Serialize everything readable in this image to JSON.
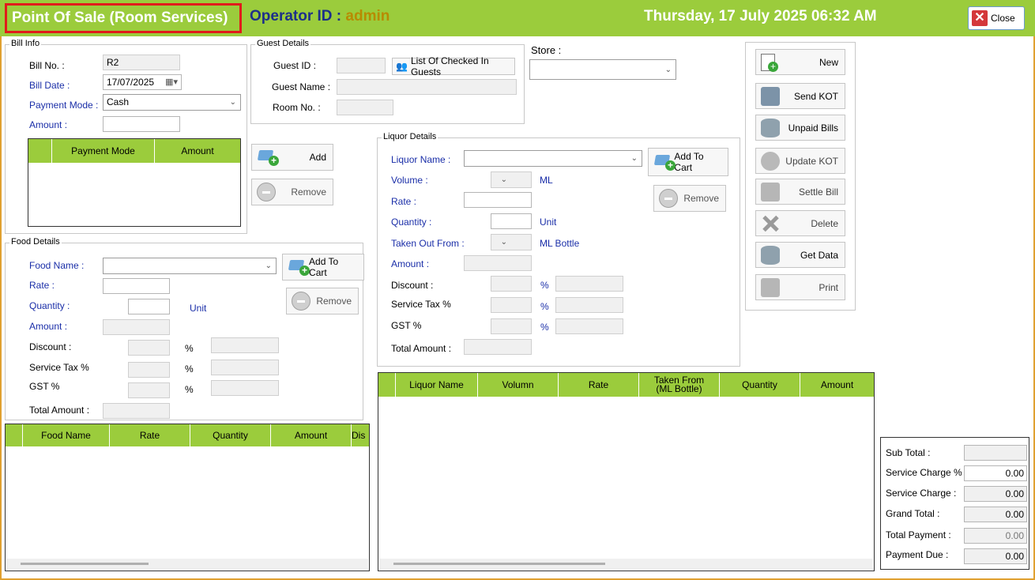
{
  "header": {
    "title": "Point Of Sale (Room Services)",
    "operator_label": "Operator ID : ",
    "operator_value": "admin",
    "datetime": "Thursday, 17 July 2025 06:32 AM",
    "close_label": "Close"
  },
  "bill_info": {
    "group_title": "Bill Info",
    "bill_no_label": "Bill No. :",
    "bill_no": "R2",
    "bill_date_label": "Bill Date :",
    "bill_date": "17/07/2025",
    "payment_mode_label": "Payment Mode :",
    "payment_mode": "Cash",
    "amount_label": "Amount :",
    "amount": "",
    "grid_columns": [
      "Payment Mode",
      "Amount"
    ],
    "add_label": "Add",
    "remove_label": "Remove"
  },
  "guest": {
    "group_title": "Guest Details",
    "guest_id_label": "Guest ID :",
    "list_button": "List Of Checked In Guests",
    "guest_name_label": "Guest Name :",
    "room_no_label": "Room No. :"
  },
  "store": {
    "label": "Store :",
    "value": ""
  },
  "food": {
    "group_title": "Food Details",
    "food_name_label": "Food Name :",
    "rate_label": "Rate :",
    "quantity_label": "Quantity :",
    "unit_label": "Unit",
    "amount_label": "Amount :",
    "discount_label": "Discount :",
    "service_tax_label": "Service Tax %",
    "gst_label": "GST %",
    "percent": "%",
    "total_amount_label": "Total Amount :",
    "add_to_cart": "Add To Cart",
    "remove_label": "Remove",
    "grid_columns": [
      "Food Name",
      "Rate",
      "Quantity",
      "Amount",
      "Dis"
    ]
  },
  "liquor": {
    "group_title": "Liquor Details",
    "liquor_name_label": "Liquor Name :",
    "volume_label": "Volume :",
    "ml_label": "ML",
    "rate_label": "Rate :",
    "quantity_label": "Quantity :",
    "unit_label": "Unit",
    "taken_out_label": "Taken Out From :",
    "ml_bottle_label": "ML Bottle",
    "amount_label": "Amount :",
    "discount_label": "Discount :",
    "service_tax_label": "Service Tax %",
    "gst_label": "GST %",
    "percent": "%",
    "total_amount_label": "Total Amount :",
    "add_to_cart": "Add To Cart",
    "remove_label": "Remove",
    "grid_columns": [
      "Liquor Name",
      "Volumn",
      "Rate",
      "Taken From\n(ML Bottle)",
      "Quantity",
      "Amount"
    ]
  },
  "actions": {
    "new": "New",
    "send_kot": "Send KOT",
    "unpaid_bills": "Unpaid Bills",
    "update_kot": "Update KOT",
    "settle_bill": "Settle Bill",
    "delete": "Delete",
    "get_data": "Get Data",
    "print": "Print"
  },
  "totals": {
    "sub_total_label": "Sub Total :",
    "sub_total": "",
    "service_charge_pct_label": "Service Charge % :",
    "service_charge_pct": "0.00",
    "service_charge_label": "Service Charge :",
    "service_charge": "0.00",
    "grand_total_label": "Grand Total :",
    "grand_total": "0.00",
    "total_payment_label": "Total Payment :",
    "total_payment": "0.00",
    "payment_due_label": "Payment Due :",
    "payment_due": "0.00"
  }
}
